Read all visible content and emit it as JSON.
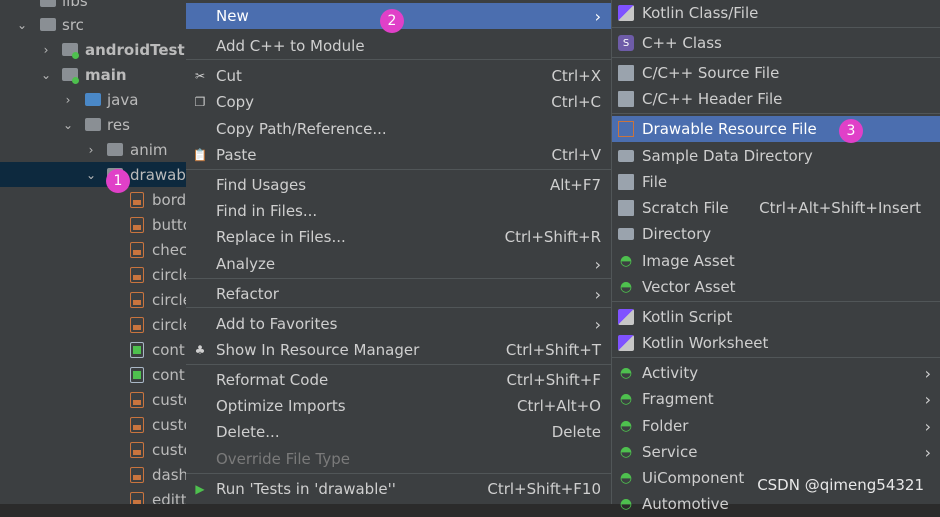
{
  "tree": {
    "rows": [
      {
        "label": "libs",
        "icon": "folder-icon"
      },
      {
        "label": "src",
        "icon": "folder-icon"
      },
      {
        "label": "androidTest",
        "icon": "folder-icon"
      },
      {
        "label": "main",
        "icon": "folder-icon"
      },
      {
        "label": "java",
        "icon": "folder-blue-icon"
      },
      {
        "label": "res",
        "icon": "res-folder-icon"
      },
      {
        "label": "anim",
        "icon": "folder-icon"
      },
      {
        "label": "drawab",
        "icon": "folder-icon"
      },
      {
        "label": "borde",
        "icon": "xml-file-icon"
      },
      {
        "label": "butto",
        "icon": "xml-file-icon"
      },
      {
        "label": "chec",
        "icon": "xml-file-icon"
      },
      {
        "label": "circle",
        "icon": "xml-file-icon"
      },
      {
        "label": "circle",
        "icon": "xml-file-icon"
      },
      {
        "label": "circle",
        "icon": "xml-file-icon"
      },
      {
        "label": "cont",
        "icon": "xml-file-icon"
      },
      {
        "label": "cont",
        "icon": "xml-file-icon"
      },
      {
        "label": "custo",
        "icon": "xml-file-icon"
      },
      {
        "label": "custo",
        "icon": "xml-file-icon"
      },
      {
        "label": "custo",
        "icon": "xml-file-icon"
      },
      {
        "label": "dash",
        "icon": "xml-file-icon"
      },
      {
        "label": "editt",
        "icon": "xml-file-icon"
      }
    ]
  },
  "context_menu": {
    "items": [
      {
        "label": "New",
        "shortcut": "",
        "submenu": true
      },
      {
        "label": "Add C++ to Module",
        "shortcut": ""
      },
      {
        "label": "Cut",
        "shortcut": "Ctrl+X",
        "icon": "scissors-icon"
      },
      {
        "label": "Copy",
        "shortcut": "Ctrl+C",
        "icon": "copy-icon"
      },
      {
        "label": "Copy Path/Reference...",
        "shortcut": ""
      },
      {
        "label": "Paste",
        "shortcut": "Ctrl+V",
        "icon": "paste-icon"
      },
      {
        "label": "Find Usages",
        "shortcut": "Alt+F7"
      },
      {
        "label": "Find in Files...",
        "shortcut": ""
      },
      {
        "label": "Replace in Files...",
        "shortcut": "Ctrl+Shift+R"
      },
      {
        "label": "Analyze",
        "shortcut": "",
        "submenu": true
      },
      {
        "label": "Refactor",
        "shortcut": "",
        "submenu": true
      },
      {
        "label": "Add to Favorites",
        "shortcut": "",
        "submenu": true
      },
      {
        "label": "Show In Resource Manager",
        "shortcut": "Ctrl+Shift+T",
        "icon": "resource-manager-icon"
      },
      {
        "label": "Reformat Code",
        "shortcut": "Ctrl+Shift+F"
      },
      {
        "label": "Optimize Imports",
        "shortcut": "Ctrl+Alt+O"
      },
      {
        "label": "Delete...",
        "shortcut": "Delete"
      },
      {
        "label": "Override File Type",
        "shortcut": ""
      },
      {
        "label": "Run 'Tests in 'drawable''",
        "shortcut": "Ctrl+Shift+F10",
        "icon": "run-icon"
      }
    ]
  },
  "new_submenu": {
    "items": [
      {
        "label": "Kotlin Class/File",
        "shortcut": ""
      },
      {
        "label": "C++ Class",
        "shortcut": ""
      },
      {
        "label": "C/C++ Source File",
        "shortcut": ""
      },
      {
        "label": "C/C++ Header File",
        "shortcut": ""
      },
      {
        "label": "Drawable Resource File",
        "shortcut": ""
      },
      {
        "label": "Sample Data Directory",
        "shortcut": ""
      },
      {
        "label": "File",
        "shortcut": ""
      },
      {
        "label": "Scratch File",
        "shortcut": "Ctrl+Alt+Shift+Insert"
      },
      {
        "label": "Directory",
        "shortcut": ""
      },
      {
        "label": "Image Asset",
        "shortcut": ""
      },
      {
        "label": "Vector Asset",
        "shortcut": ""
      },
      {
        "label": "Kotlin Script",
        "shortcut": ""
      },
      {
        "label": "Kotlin Worksheet",
        "shortcut": ""
      },
      {
        "label": "Activity",
        "shortcut": ""
      },
      {
        "label": "Fragment",
        "shortcut": ""
      },
      {
        "label": "Folder",
        "shortcut": ""
      },
      {
        "label": "Service",
        "shortcut": ""
      },
      {
        "label": "UiComponent",
        "shortcut": ""
      },
      {
        "label": "Automotive",
        "shortcut": ""
      }
    ]
  },
  "annotations": {
    "b1": "1",
    "b2": "2",
    "b3": "3"
  },
  "watermark": "CSDN @qimeng54321",
  "colors": {
    "highlight": "#4b6eaf",
    "badge": "#e040c8",
    "android_green": "#4ec04e"
  }
}
